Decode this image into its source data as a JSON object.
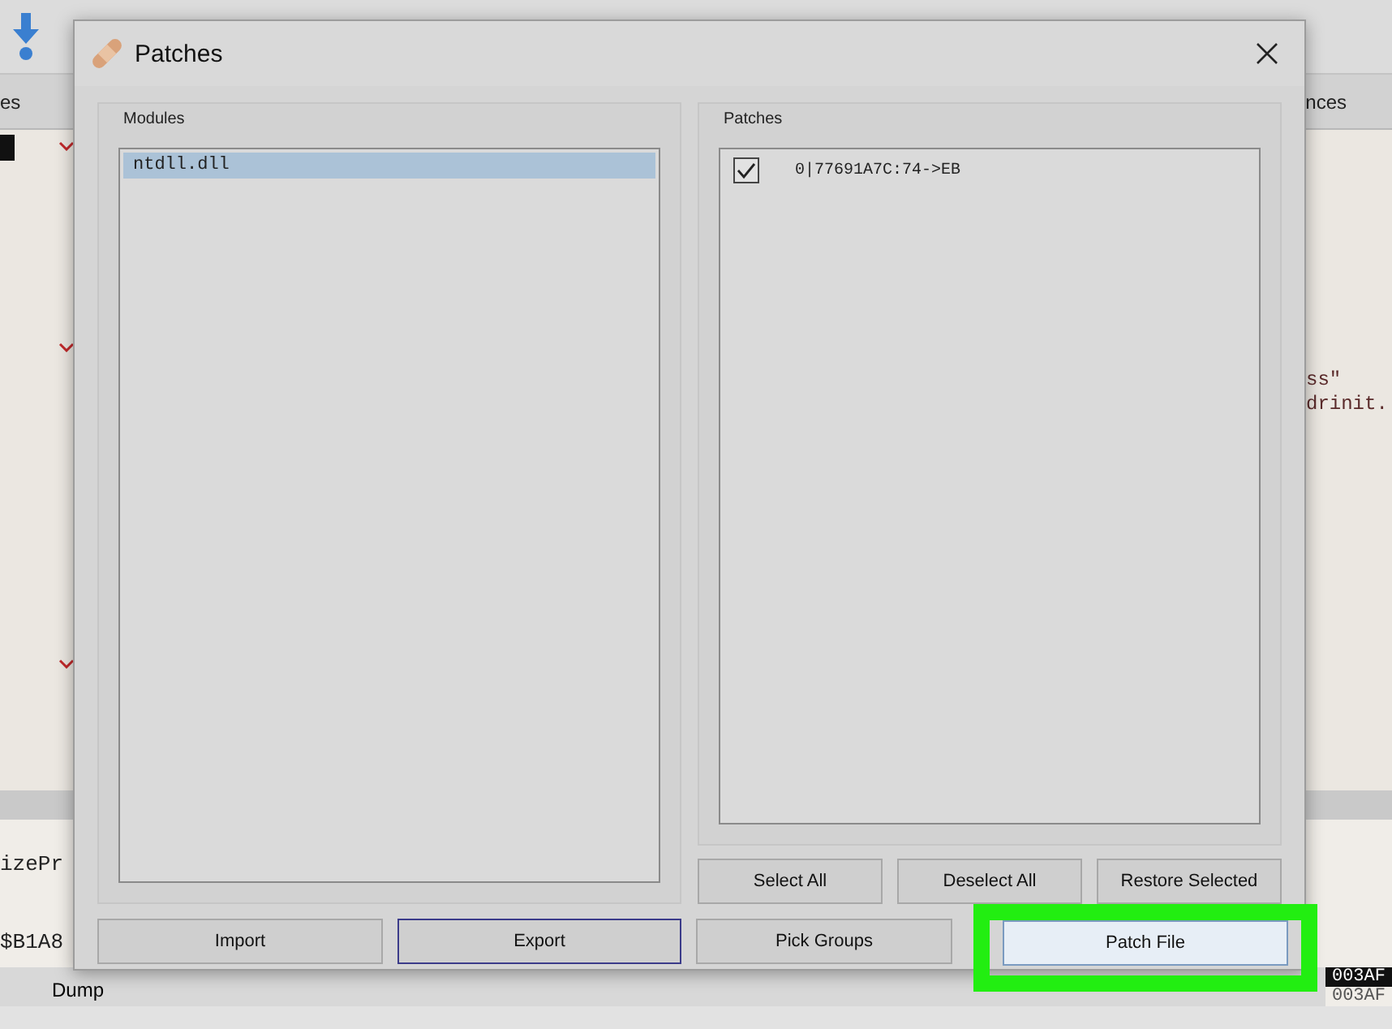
{
  "background_app": {
    "tabs": [
      {
        "label": "es"
      },
      {
        "label": "nces"
      }
    ],
    "code_lines": [
      "ss\"",
      "drinit."
    ],
    "lower_lines": [
      "izePr",
      "$B1A8"
    ],
    "bottom_tab": "Dump",
    "addresses": [
      {
        "text": "003AF",
        "selected": true
      },
      {
        "text": "003AF",
        "selected": false
      }
    ]
  },
  "dialog": {
    "title": "Patches",
    "modules": {
      "label": "Modules",
      "items": [
        {
          "name": "ntdll.dll",
          "selected": true
        }
      ]
    },
    "patches": {
      "label": "Patches",
      "items": [
        {
          "text": "0|77691A7C:74->EB",
          "checked": true
        }
      ]
    },
    "patch_buttons": [
      {
        "label": "Select All"
      },
      {
        "label": "Deselect All"
      },
      {
        "label": "Restore Selected"
      }
    ],
    "bottom_buttons": [
      {
        "label": "Import",
        "focused": false,
        "highlighted": false
      },
      {
        "label": "Export",
        "focused": true,
        "highlighted": false
      },
      {
        "label": "Pick Groups",
        "focused": false,
        "highlighted": false
      },
      {
        "label": "Patch File",
        "focused": false,
        "highlighted": true
      }
    ]
  }
}
